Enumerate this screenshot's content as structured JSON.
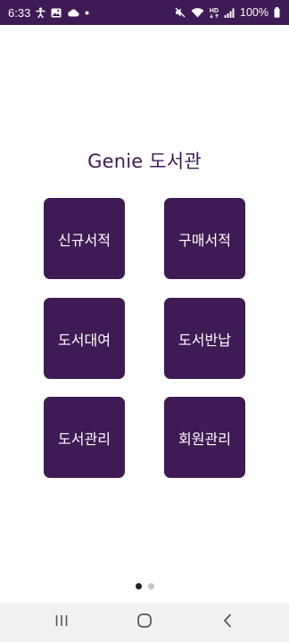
{
  "status_bar": {
    "time": "6:33",
    "battery": "100%",
    "left_icons": [
      "accessibility-icon",
      "gallery-icon",
      "cloud-icon",
      "dot-icon"
    ],
    "right_icons": [
      "mute-icon",
      "wifi-icon",
      "hd-icon",
      "signal-icon",
      "battery-icon"
    ],
    "hd_label": "HD"
  },
  "app": {
    "title": "Genie 도서관",
    "brand_color": "#3e1b55"
  },
  "menu": {
    "items": [
      {
        "label": "신규서적"
      },
      {
        "label": "구매서적"
      },
      {
        "label": "도서대여"
      },
      {
        "label": "도서반납"
      },
      {
        "label": "도서관리"
      },
      {
        "label": "회원관리"
      }
    ]
  },
  "pager": {
    "page_count": 2,
    "current_page": 1
  },
  "nav_bar": {
    "buttons": [
      "recent-apps-icon",
      "home-icon",
      "back-icon"
    ]
  }
}
